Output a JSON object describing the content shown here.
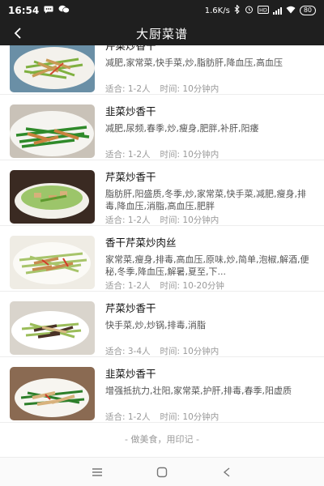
{
  "status_bar": {
    "time": "16:54",
    "speed": "1.6K/s",
    "battery": "80"
  },
  "header": {
    "title": "大厨菜谱"
  },
  "recipes": [
    {
      "title": "芹菜炒香干",
      "tags": "减肥,家常菜,快手菜,炒,脂肪肝,降血压,高血压",
      "servings": "适合: 1-2人",
      "time": "时间: 10分钟内",
      "image": "celery-tofu-plate"
    },
    {
      "title": "韭菜炒香干",
      "tags": "减肥,尿频,春季,炒,瘦身,肥胖,补肝,阳痿",
      "servings": "适合: 1-2人",
      "time": "时间: 10分钟内",
      "image": "chive-tofu-plate"
    },
    {
      "title": "芹菜炒香干",
      "tags": "脂肪肝,阳盛质,冬季,炒,家常菜,快手菜,减肥,瘦身,排毒,降血压,消脂,高血压,肥胖",
      "servings": "适合: 1-2人",
      "time": "时间: 10分钟内",
      "image": "celery-tofu-bowl"
    },
    {
      "title": "香干芹菜炒肉丝",
      "tags": "家常菜,瘦身,排毒,高血压,原味,炒,简单,泡椒,解酒,便秘,冬季,降血压,解暑,夏至,下...",
      "servings": "适合: 1-2人",
      "time": "时间: 10-20分钟",
      "image": "pork-celery-plate"
    },
    {
      "title": "芹菜炒香干",
      "tags": "快手菜,炒,炒锅,排毒,消脂",
      "servings": "适合: 3-4人",
      "time": "时间: 10分钟内",
      "image": "celery-tofu-dish"
    },
    {
      "title": "韭菜炒香干",
      "tags": "增强抵抗力,壮阳,家常菜,护肝,排毒,春季,阳虚质",
      "servings": "适合: 1-2人",
      "time": "时间: 10分钟内",
      "image": "chive-tofu-dish"
    }
  ],
  "footer": {
    "note": "- 做美食，用印记 -"
  },
  "colors": {
    "bar_background": "#1f1f1f",
    "title_text": "#111111",
    "tag_text": "#555555",
    "meta_text": "#999999"
  }
}
